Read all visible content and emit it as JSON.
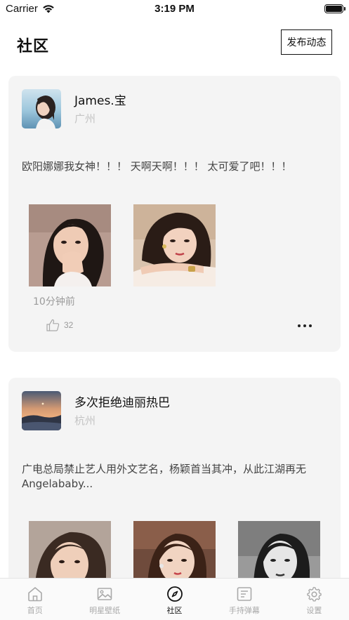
{
  "status_bar": {
    "carrier": "Carrier",
    "time": "3:19 PM"
  },
  "header": {
    "title": "社区",
    "post_button": "发布动态"
  },
  "posts": [
    {
      "name": "James.宝",
      "location": "广州",
      "text": "欧阳娜娜我女神！！！ 天啊天啊！！！ 太可爱了吧！！！",
      "time_ago": "10分钟前",
      "likes": "32",
      "photo_count": 2
    },
    {
      "name": "多次拒绝迪丽热巴",
      "location": "杭州",
      "text": "广电总局禁止艺人用外文艺名，杨颖首当其冲，从此江湖再无Angelababy...",
      "photo_count": 3
    }
  ],
  "tabs": [
    {
      "label": "首页",
      "icon": "home-icon",
      "active": false
    },
    {
      "label": "明星壁纸",
      "icon": "image-icon",
      "active": false
    },
    {
      "label": "社区",
      "icon": "compass-icon",
      "active": true
    },
    {
      "label": "手持弹幕",
      "icon": "text-lines-icon",
      "active": false
    },
    {
      "label": "设置",
      "icon": "gear-icon",
      "active": false
    }
  ],
  "colors": {
    "card_bg": "#f4f4f4",
    "muted_text": "#9a9a9a",
    "location_text": "#c4c4c4",
    "active_tab": "#111111",
    "inactive_tab": "#a9a9a9"
  }
}
